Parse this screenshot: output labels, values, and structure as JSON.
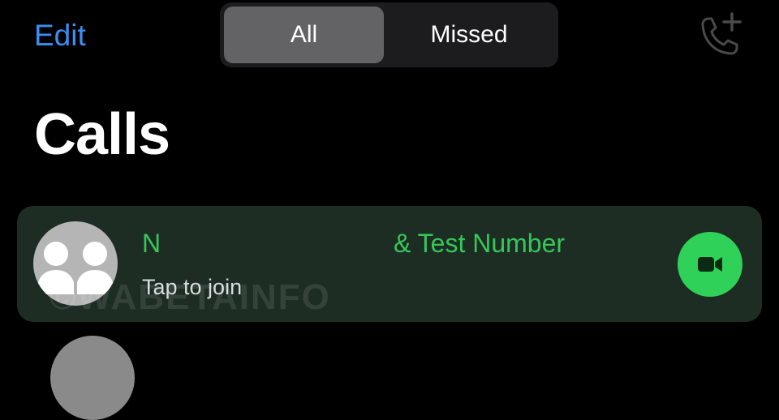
{
  "header": {
    "edit_label": "Edit",
    "segments": [
      {
        "label": "All",
        "selected": true
      },
      {
        "label": "Missed",
        "selected": false
      }
    ],
    "add_call_icon": "phone-plus-icon"
  },
  "page_title": "Calls",
  "calls": [
    {
      "participant_first": "N",
      "participant_second": "& Test Number",
      "subtitle": "Tap to join",
      "action_icon": "video-camera-icon",
      "avatar_icon": "group-avatar-icon"
    }
  ],
  "watermark": "©WABETAINFO",
  "colors": {
    "accent_blue": "#3d8ef0",
    "active_green": "#34c759",
    "call_button_green": "#30d158",
    "row_background": "#1e2d23"
  }
}
